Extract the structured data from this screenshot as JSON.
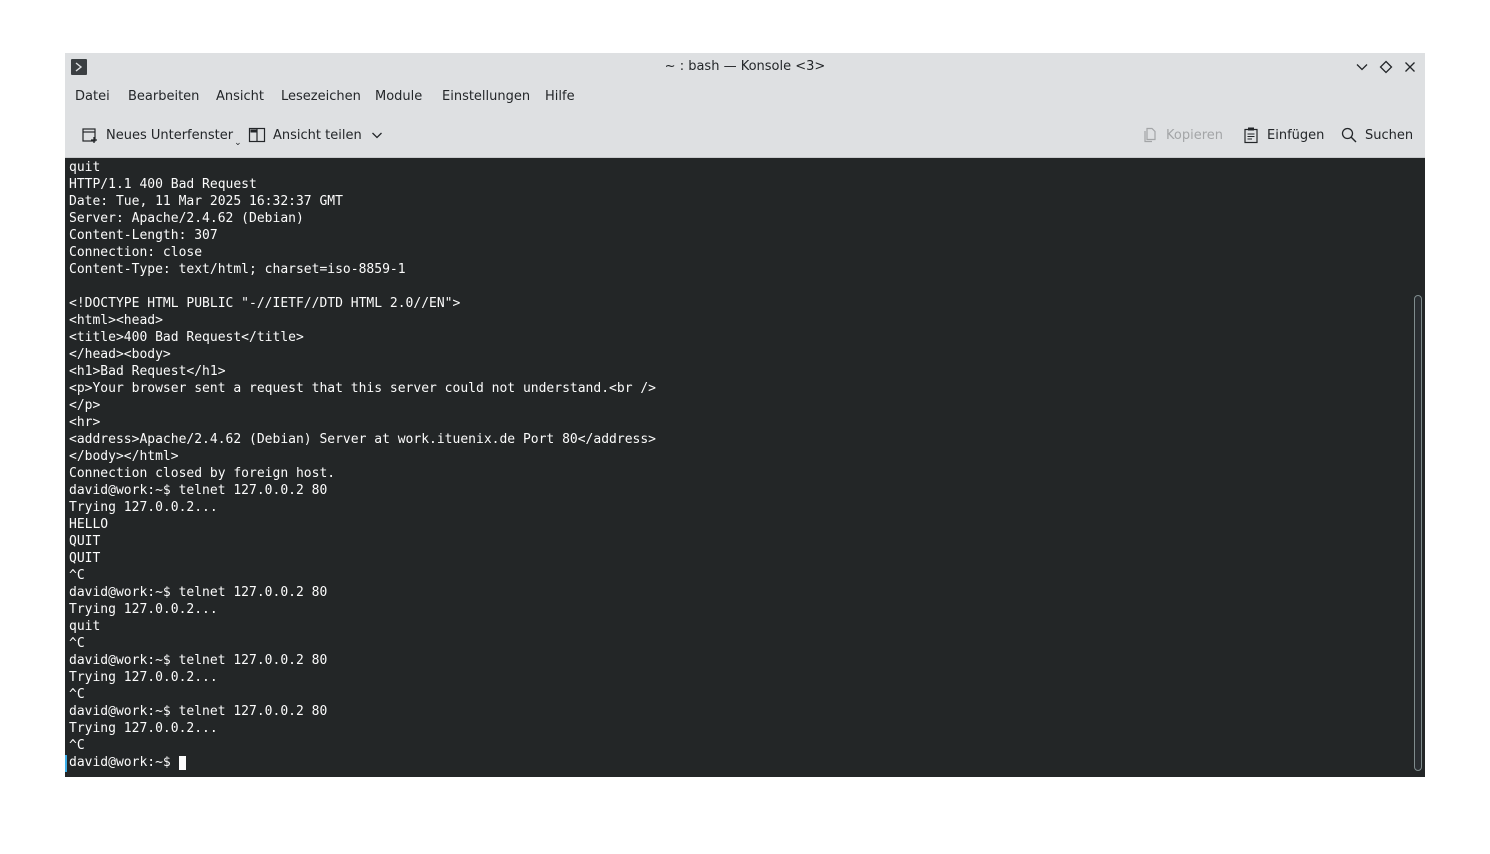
{
  "window": {
    "title": "~ : bash — Konsole <3>"
  },
  "menu": [
    "Datei",
    "Bearbeiten",
    "Ansicht",
    "Lesezeichen",
    "Module",
    "Einstellungen",
    "Hilfe"
  ],
  "toolbar": {
    "new_tab_label": "Neues Unterfenster",
    "split_view_label": "Ansicht teilen",
    "copy_label": "Kopieren",
    "paste_label": "Einfügen",
    "search_label": "Suchen"
  },
  "terminal": {
    "lines": [
      "quit",
      "HTTP/1.1 400 Bad Request",
      "Date: Tue, 11 Mar 2025 16:32:37 GMT",
      "Server: Apache/2.4.62 (Debian)",
      "Content-Length: 307",
      "Connection: close",
      "Content-Type: text/html; charset=iso-8859-1",
      "",
      "<!DOCTYPE HTML PUBLIC \"-//IETF//DTD HTML 2.0//EN\">",
      "<html><head>",
      "<title>400 Bad Request</title>",
      "</head><body>",
      "<h1>Bad Request</h1>",
      "<p>Your browser sent a request that this server could not understand.<br />",
      "</p>",
      "<hr>",
      "<address>Apache/2.4.62 (Debian) Server at work.ituenix.de Port 80</address>",
      "</body></html>",
      "Connection closed by foreign host.",
      "david@work:~$ telnet 127.0.0.2 80",
      "Trying 127.0.0.2...",
      "HELLO",
      "QUIT",
      "QUIT",
      "^C",
      "david@work:~$ telnet 127.0.0.2 80",
      "Trying 127.0.0.2...",
      "quit",
      "^C",
      "david@work:~$ telnet 127.0.0.2 80",
      "Trying 127.0.0.2...",
      "^C",
      "david@work:~$ telnet 127.0.0.2 80",
      "Trying 127.0.0.2...",
      "^C"
    ],
    "prompt": "david@work:~$ "
  },
  "colors": {
    "terminal_bg": "#232627",
    "terminal_fg": "#fcfcfc",
    "chrome_bg": "#dee0e2",
    "accent": "#3daee9"
  }
}
